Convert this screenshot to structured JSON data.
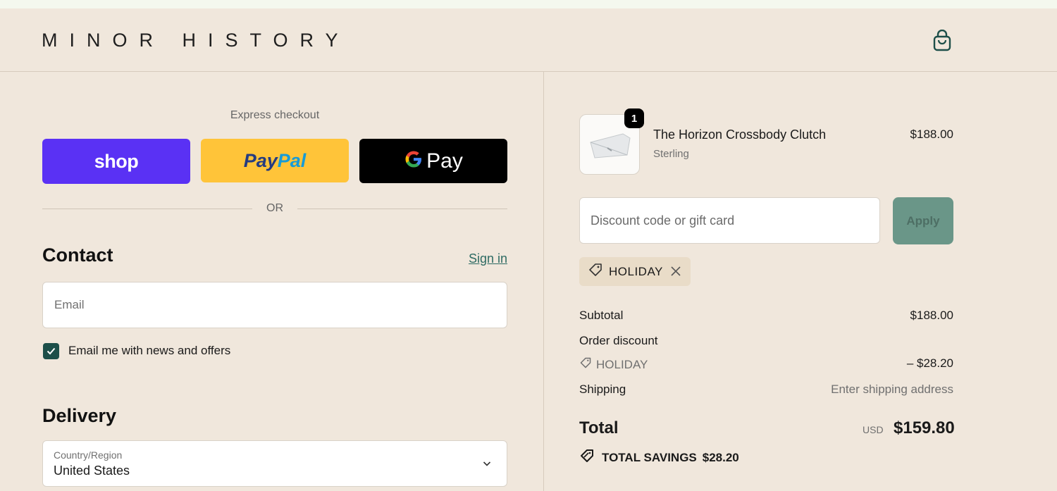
{
  "header": {
    "logo": "MINOR HISTORY",
    "cart_icon": "shopping-bag-icon"
  },
  "express": {
    "title": "Express checkout",
    "shop_label": "shop",
    "paypal_label_pay": "Pay",
    "paypal_label_pal": "Pal",
    "gpay_label": "Pay",
    "or": "OR"
  },
  "contact": {
    "title": "Contact",
    "sign_in": "Sign in",
    "email_placeholder": "Email",
    "news_label": "Email me with news and offers",
    "news_checked": true
  },
  "delivery": {
    "title": "Delivery",
    "country_label": "Country/Region",
    "country_value": "United States"
  },
  "order": {
    "product": {
      "name": "The Horizon Crossbody Clutch",
      "variant": "Sterling",
      "price": "$188.00",
      "quantity": "1"
    },
    "discount_placeholder": "Discount code or gift card",
    "apply_label": "Apply",
    "applied_code": "HOLIDAY",
    "subtotal_label": "Subtotal",
    "subtotal_value": "$188.00",
    "order_discount_label": "Order discount",
    "discount_code": "HOLIDAY",
    "discount_value": "– $28.20",
    "shipping_label": "Shipping",
    "shipping_value": "Enter shipping address",
    "total_label": "Total",
    "currency": "USD",
    "total_value": "$159.80",
    "savings_label": "TOTAL SAVINGS",
    "savings_value": "$28.20"
  },
  "colors": {
    "background": "#f0e7dc",
    "shop_purple": "#5a31f4",
    "paypal_yellow": "#ffc439",
    "accent_green": "#1d4f49",
    "apply_green": "#6a9688"
  }
}
